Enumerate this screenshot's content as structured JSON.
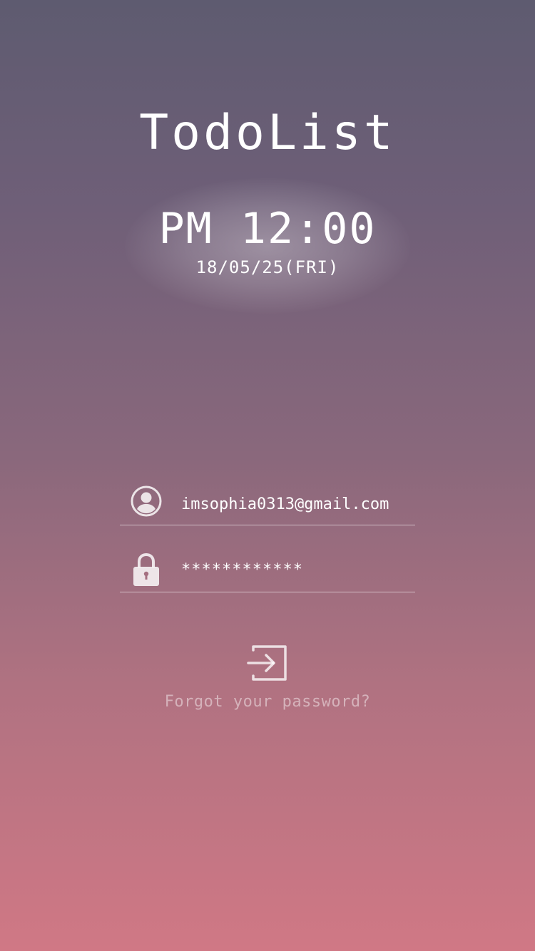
{
  "app": {
    "title": "TodoList"
  },
  "clock": {
    "time": "PM 12:00",
    "date": "18/05/25(FRI)"
  },
  "login_form": {
    "email": {
      "value": "imsophia0313@gmail.com",
      "icon": "user-avatar-icon"
    },
    "password": {
      "value": "************",
      "icon": "lock-icon"
    },
    "submit": {
      "icon": "sign-in-icon"
    },
    "forgot_password_label": "Forgot your password?"
  },
  "colors": {
    "gradient_top": "#5e5b70",
    "gradient_bottom": "#d07885",
    "text": "#ffffff"
  }
}
